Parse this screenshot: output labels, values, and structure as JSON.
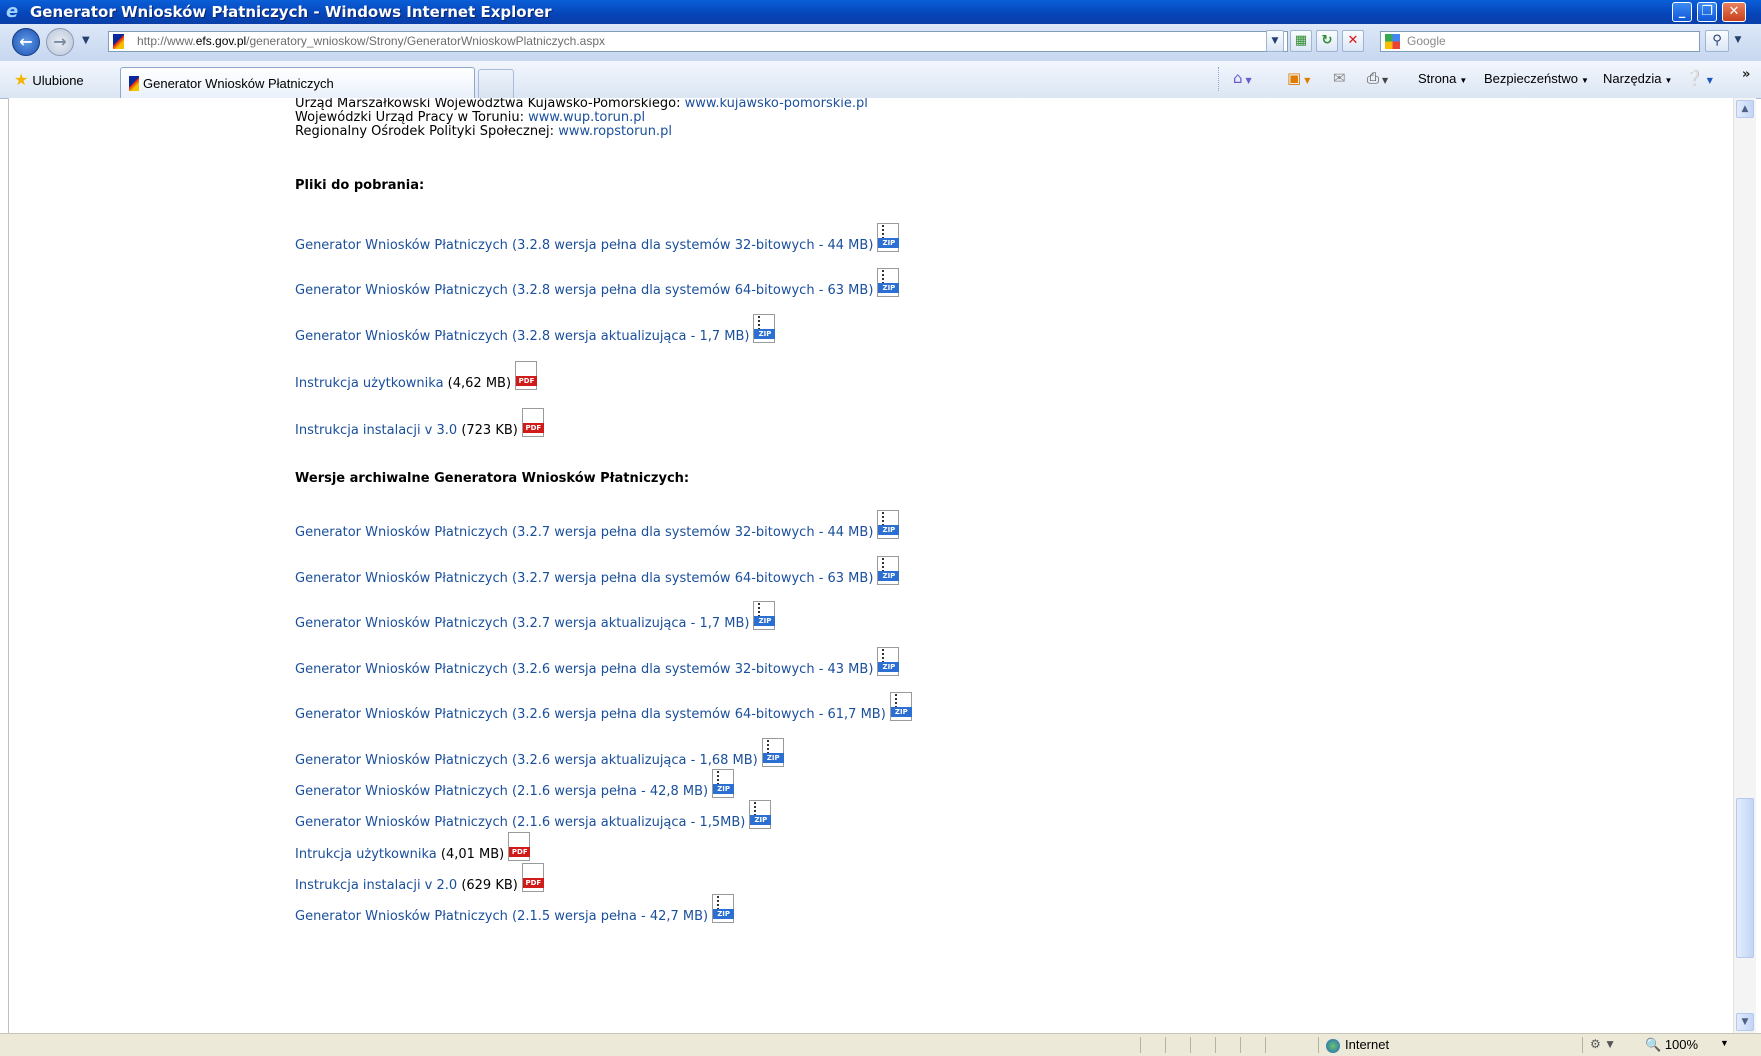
{
  "window": {
    "title": "Generator Wniosków Płatniczych - Windows Internet Explorer",
    "minimize": "_",
    "maximize": "❐",
    "close": "✕"
  },
  "address": {
    "url_prefix": "http://www.",
    "url_domain": "efs.gov.pl",
    "url_path": "/generatory_wnioskow/Strony/GeneratorWnioskowPlatniczych.aspx",
    "search_placeholder": "Google"
  },
  "favorites_bar": {
    "favorites_label": "Ulubione",
    "tab_title": "Generator Wniosków Płatniczych",
    "strona": "Strona",
    "bezpieczenstwo": "Bezpieczeństwo",
    "narzedzia": "Narzędzia"
  },
  "page": {
    "top_partial_prefix": "Urząd Marszałkowski Województwa Kujawsko-Pomorskiego:",
    "top_partial_link": "www.kujawsko-pomorskie.pl",
    "wup_prefix": "Wojewódzki Urząd Pracy w Toruniu:",
    "wup_link": "www.wup.torun.pl",
    "rops_prefix": "Regionalny Ośrodek Polityki Społecznej:",
    "rops_link": "www.ropstorun.pl",
    "downloads_heading": "Pliki do pobrania:",
    "archive_heading": "Wersje archiwalne Generatora Wniosków Płatniczych:"
  },
  "downloads": [
    {
      "link": "Generator Wniosków Płatniczych (3.2.8 wersja pełna dla systemów 32-bitowych - 44 MB)",
      "extra": "",
      "type": "zip",
      "icon_label": "ZIP"
    },
    {
      "link": "Generator Wniosków Płatniczych (3.2.8 wersja pełna dla systemów 64-bitowych - 63 MB)",
      "extra": "",
      "type": "zip",
      "icon_label": "ZIP"
    },
    {
      "link": "Generator Wniosków Płatniczych (3.2.8 wersja aktualizująca - 1,7 MB)",
      "extra": "",
      "type": "zip",
      "icon_label": "ZIP"
    },
    {
      "link": "Instrukcja użytkownika",
      "extra": " (4,62 MB)",
      "type": "pdf",
      "icon_label": "PDF"
    },
    {
      "link": "Instrukcja instalacji v 3.0",
      "extra": " (723 KB)",
      "type": "pdf",
      "icon_label": "PDF"
    }
  ],
  "archive": [
    {
      "link": "Generator Wniosków Płatniczych (3.2.7 wersja pełna dla systemów 32-bitowych - 44 MB)",
      "extra": "",
      "type": "zip",
      "icon_label": "ZIP"
    },
    {
      "link": "Generator Wniosków Płatniczych (3.2.7 wersja pełna dla systemów 64-bitowych - 63 MB)",
      "extra": "",
      "type": "zip",
      "icon_label": "ZIP"
    },
    {
      "link": "Generator Wniosków Płatniczych (3.2.7 wersja aktualizująca - 1,7 MB)",
      "extra": "",
      "type": "zip",
      "icon_label": "ZIP"
    },
    {
      "link": "Generator Wniosków Płatniczych (3.2.6 wersja pełna dla systemów 32-bitowych - 43 MB)",
      "extra": "",
      "type": "zip",
      "icon_label": "ZIP"
    },
    {
      "link": "Generator Wniosków Płatniczych (3.2.6 wersja pełna dla systemów 64-bitowych - 61,7 MB)",
      "extra": "",
      "type": "zip",
      "icon_label": "ZIP"
    },
    {
      "link": "Generator Wniosków Płatniczych (3.2.6 wersja aktualizująca - 1,68 MB)",
      "extra": "",
      "type": "zip",
      "icon_label": "ZIP"
    },
    {
      "link": "Generator Wniosków Płatniczych (2.1.6 wersja pełna - 42,8 MB)",
      "extra": "",
      "type": "zip",
      "icon_label": "ZIP"
    },
    {
      "link": "Generator Wniosków Płatniczych (2.1.6 wersja aktualizująca - 1,5MB)",
      "extra": "",
      "type": "zip",
      "icon_label": "ZIP"
    },
    {
      "link": "Intrukcja użytkownika",
      "extra": " (4,01 MB)",
      "type": "pdf",
      "icon_label": "PDF"
    },
    {
      "link": "Instrukcja instalacji v 2.0",
      "extra": " (629 KB)",
      "type": "pdf",
      "icon_label": "PDF"
    },
    {
      "link": "Generator Wniosków Płatniczych (2.1.5 wersja pełna - 42,7 MB)",
      "extra": "",
      "type": "zip",
      "icon_label": "ZIP"
    }
  ],
  "status": {
    "zone": "Internet",
    "zoom": "100%"
  },
  "colors": {
    "link": "#1a4f9c",
    "zip_badge": "#2a6fd1",
    "pdf_badge": "#d01b1b",
    "titlebar": "#0644b8"
  }
}
